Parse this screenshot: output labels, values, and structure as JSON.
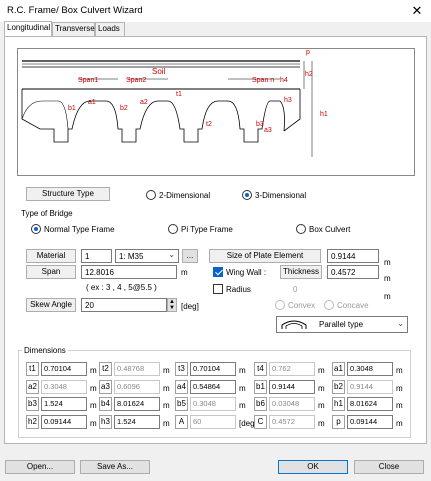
{
  "window": {
    "title": "R.C. Frame/ Box Culvert Wizard"
  },
  "tabs": [
    {
      "label": "Longitudinal"
    },
    {
      "label": "Transverse"
    },
    {
      "label": "Loads"
    }
  ],
  "drawing": {
    "labels": {
      "p": "p",
      "h2": "h2",
      "soil": "Soil",
      "span1": "Span1",
      "span2": "Span2",
      "spann": "Span n",
      "h4": "h4",
      "h3": "h3",
      "h1": "h1",
      "a1": "a1",
      "b1": "b1",
      "a2": "a2",
      "b2": "b2",
      "t1": "t1",
      "t2": "t2",
      "b3": "b3",
      "a3": "a3"
    }
  },
  "structure_type": {
    "label": "Structure Type",
    "options": [
      "2-Dimensional",
      "3-Dimensional"
    ],
    "selected": "3-Dimensional"
  },
  "type_of_bridge": {
    "title": "Type of Bridge",
    "options": [
      "Normal Type Frame",
      "Pi Type Frame",
      "Box Culvert"
    ],
    "selected": "Normal Type Frame"
  },
  "material": {
    "label": "Material",
    "id": "1",
    "grade": "1: M35",
    "browse": "..."
  },
  "plate": {
    "label": "Size of Plate Element",
    "value": "0.9144",
    "unit": "m"
  },
  "span": {
    "label": "Span",
    "value": "12.8016",
    "unit": "m",
    "example": "( ex : 3 , 4 , 5@5.5 )"
  },
  "wing_wall": {
    "label": "Wing Wall :",
    "checked": true,
    "thickness_label": "Thickness",
    "thickness": "0.4572",
    "unit": "m"
  },
  "radius": {
    "label": "Radius",
    "checked": false,
    "value": "0",
    "unit": "m"
  },
  "skew": {
    "label": "Skew Angle",
    "value": "20",
    "unit": "[deg]"
  },
  "shape": {
    "options": [
      "Convex",
      "Concave"
    ],
    "parallel": "Parallel type"
  },
  "dimensions": {
    "title": "Dimensions",
    "rows": [
      [
        {
          "k": "t1",
          "v": "0.70104",
          "u": "m"
        },
        {
          "k": "t2",
          "v": "0.48768",
          "u": "m",
          "dis": true
        },
        {
          "k": "t3",
          "v": "0.70104",
          "u": "m"
        },
        {
          "k": "t4",
          "v": "0.762",
          "u": "m",
          "dis": true
        },
        {
          "k": "a1",
          "v": "0.3048",
          "u": "m"
        }
      ],
      [
        {
          "k": "a2",
          "v": "0.3048",
          "u": "m",
          "dis": true
        },
        {
          "k": "a3",
          "v": "0.6096",
          "u": "m",
          "dis": true
        },
        {
          "k": "a4",
          "v": "0.54864",
          "u": "m"
        },
        {
          "k": "b1",
          "v": "0.9144",
          "u": "m"
        },
        {
          "k": "b2",
          "v": "0.9144",
          "u": "m",
          "dis": true
        }
      ],
      [
        {
          "k": "b3",
          "v": "1.524",
          "u": "m"
        },
        {
          "k": "b4",
          "v": "8.01624",
          "u": "m"
        },
        {
          "k": "b5",
          "v": "0.3048",
          "u": "m",
          "dis": true
        },
        {
          "k": "b6",
          "v": "0.03048",
          "u": "m",
          "dis": true
        },
        {
          "k": "h1",
          "v": "8.01624",
          "u": "m"
        }
      ],
      [
        {
          "k": "h2",
          "v": "0.09144",
          "u": "m"
        },
        {
          "k": "h3",
          "v": "1.524",
          "u": "m"
        },
        {
          "k": "A",
          "v": "60",
          "u": "[deg]",
          "dis": true
        },
        {
          "k": "C",
          "v": "0.4572",
          "u": "m",
          "dis": true
        },
        {
          "k": "p",
          "v": "0.09144",
          "u": "m"
        }
      ]
    ]
  },
  "footer": {
    "open": "Open...",
    "save_as": "Save As...",
    "ok": "OK",
    "close": "Close"
  }
}
